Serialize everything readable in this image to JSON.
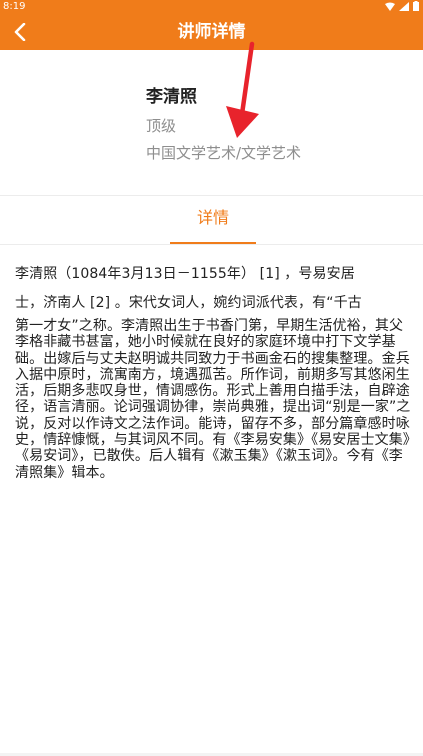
{
  "status_bar": {
    "time": "8:19",
    "icons": [
      "wifi-icon",
      "signal-icon",
      "battery-icon"
    ]
  },
  "app_bar": {
    "title": "讲师详情",
    "back_icon": "back-arrow-icon",
    "color": "#f07c1a"
  },
  "lecturer": {
    "name": "李清照",
    "rank": "顶级",
    "category": "中国文学艺术/文学艺术"
  },
  "tabs": [
    {
      "label": "详情",
      "active": true
    }
  ],
  "detail": {
    "lead_lines": [
      "李清照（1084年3月13日－1155年） [1] ，号易安居",
      "士，济南人 [2] 。宋代女词人，婉约词派代表，有“千古"
    ],
    "body": "第一才女”之称。李清照出生于书香门第，早期生活优裕，其父李格非藏书甚富，她小时候就在良好的家庭环境中打下文学基础。出嫁后与丈夫赵明诚共同致力于书画金石的搜集整理。金兵入据中原时，流寓南方，境遇孤苦。所作词，前期多写其悠闲生活，后期多悲叹身世，情调感伤。形式上善用白描手法，自辟途径，语言清丽。论词强调协律，崇尚典雅，提出词“别是一家”之说，反对以作诗文之法作词。能诗，留存不多，部分篇章感时咏史，情辞慷慨，与其词风不同。有《李易安集》《易安居士文集》《易安词》，已散佚。后人辑有《漱玉集》《漱玉词》。今有《李清照集》辑本。"
  },
  "colors": {
    "accent": "#f07c1a",
    "annotation_arrow": "#e8232c",
    "muted_text": "#8e8e8e"
  }
}
